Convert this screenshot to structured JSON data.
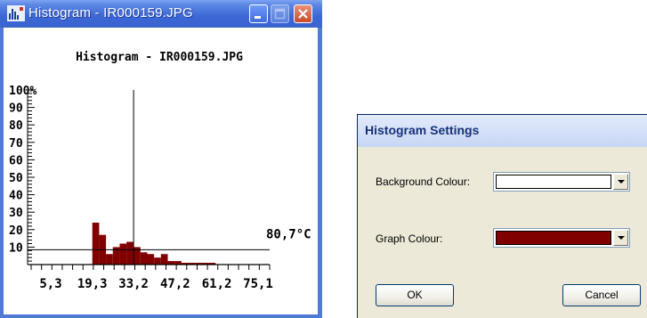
{
  "histogram_window": {
    "title": "Histogram - IR000159.JPG",
    "icons": {
      "app": "histogram-app-icon",
      "minimize": "minimize-icon",
      "maximize": "maximize-icon",
      "close": "close-icon"
    },
    "colors": {
      "titlebar": "#3c67d4",
      "graph": "#800000",
      "background": "#ffffff"
    },
    "chart_data": {
      "type": "bar",
      "title": "Histogram - IR000159.JPG",
      "x_tick_labels": [
        "5,3",
        "19,3",
        "33,2",
        "47,2",
        "61,2",
        "75,1"
      ],
      "y_tick_labels": [
        "10",
        "20",
        "30",
        "40",
        "50",
        "60",
        "70",
        "80",
        "90",
        "100"
      ],
      "y_unit": "%",
      "ylim": [
        0,
        100
      ],
      "xlim": [
        5.3,
        80.7
      ],
      "x": [
        19.3,
        21.6,
        23.9,
        26.2,
        28.5,
        30.8,
        33.2,
        35.5,
        37.8,
        40.1,
        42.4,
        44.7,
        47.0,
        49.3,
        51.6,
        53.9,
        56.2,
        58.5
      ],
      "values": [
        24,
        17,
        6,
        10,
        12,
        13,
        10,
        7,
        6,
        4,
        6,
        2,
        2,
        1,
        1,
        1,
        1,
        1
      ],
      "cursor_x": 33.2,
      "threshold_label": "80,7°C",
      "threshold_y": 10
    }
  },
  "settings_dialog": {
    "title": "Histogram Settings",
    "background_label": "Background Colour:",
    "background_value": "#ffffff",
    "graph_label": "Graph Colour:",
    "graph_value": "#800000",
    "ok_label": "OK",
    "cancel_label": "Cancel"
  }
}
